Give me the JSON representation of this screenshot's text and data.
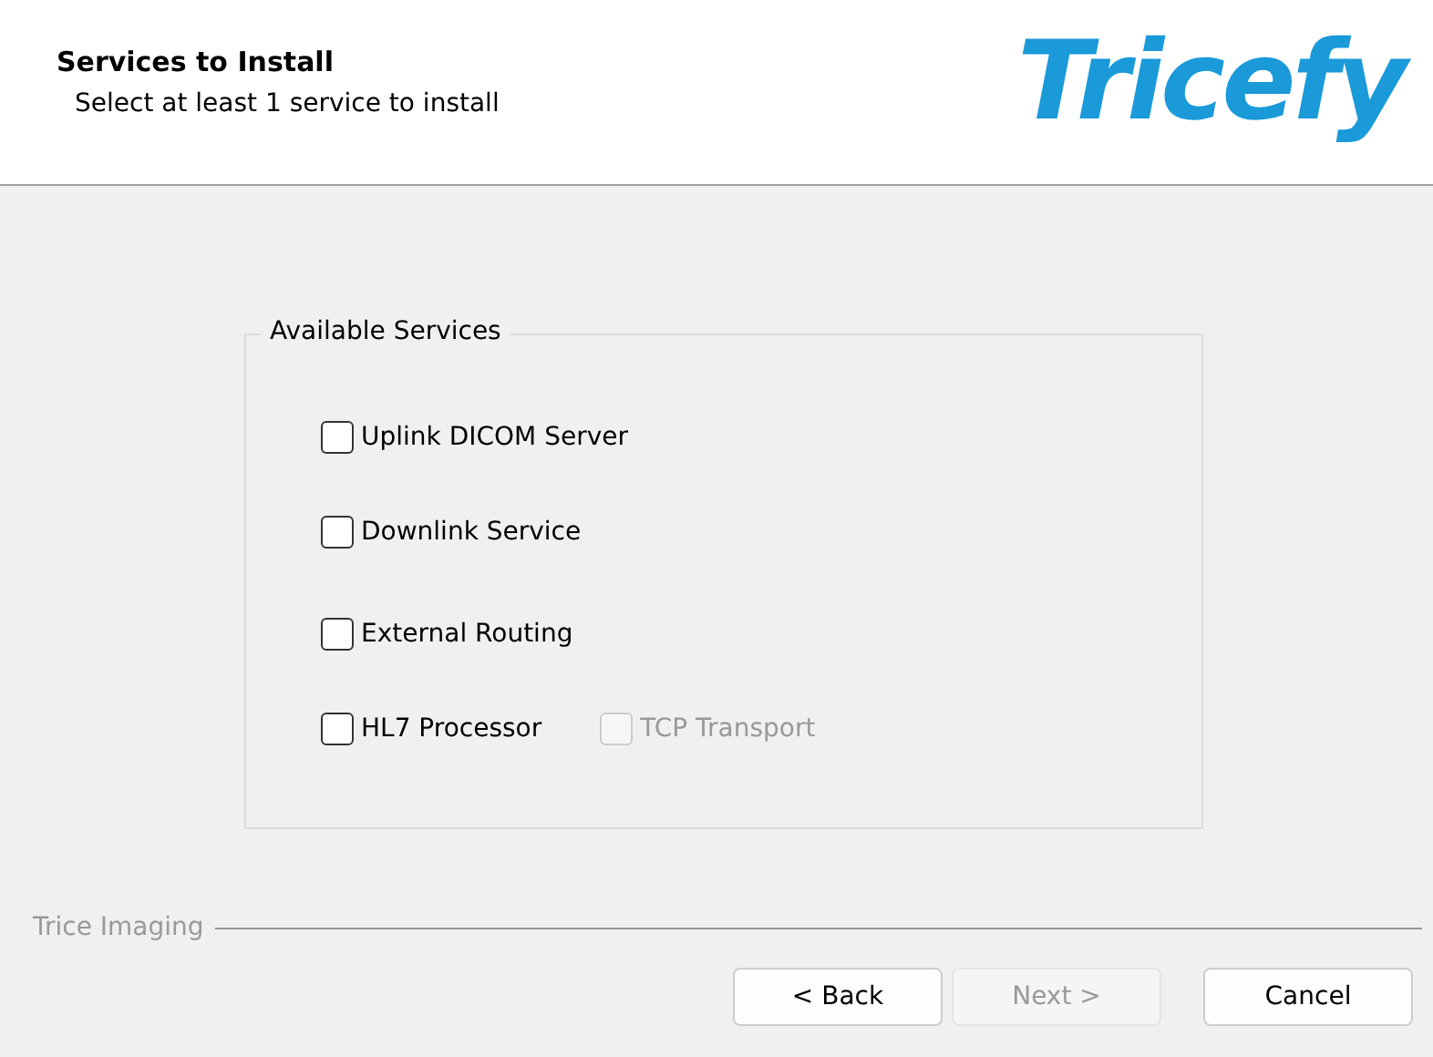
{
  "header": {
    "title": "Services to Install",
    "subtitle": "Select at least 1 service to install",
    "logo": "Tricefy"
  },
  "group": {
    "title": "Available Services",
    "rows": [
      {
        "items": [
          {
            "label": "Uplink DICOM Server",
            "checked": false,
            "disabled": false
          }
        ]
      },
      {
        "items": [
          {
            "label": "Downlink Service",
            "checked": false,
            "disabled": false
          }
        ]
      },
      {
        "items": [
          {
            "label": "External Routing",
            "checked": false,
            "disabled": false
          }
        ]
      },
      {
        "items": [
          {
            "label": "HL7 Processor",
            "checked": false,
            "disabled": false
          },
          {
            "label": "TCP Transport",
            "checked": false,
            "disabled": true
          }
        ]
      }
    ]
  },
  "footer": {
    "brand": "Trice Imaging",
    "buttons": [
      {
        "label": "< Back",
        "disabled": false
      },
      {
        "label": "Next >",
        "disabled": true
      },
      {
        "label": "Cancel",
        "disabled": false
      }
    ]
  }
}
